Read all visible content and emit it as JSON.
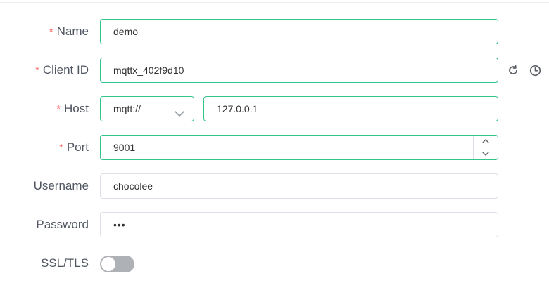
{
  "form": {
    "name": {
      "label": "Name",
      "required_mark": "*",
      "value": "demo"
    },
    "client_id": {
      "label": "Client ID",
      "required_mark": "*",
      "value": "mqttx_402f9d10"
    },
    "host": {
      "label": "Host",
      "required_mark": "*",
      "protocol": "mqtt://",
      "value": "127.0.0.1"
    },
    "port": {
      "label": "Port",
      "required_mark": "*",
      "value": "9001"
    },
    "username": {
      "label": "Username",
      "value": "chocolee"
    },
    "password": {
      "label": "Password",
      "value": "•••"
    },
    "ssl": {
      "label": "SSL/TLS",
      "enabled": false
    }
  },
  "icons": {
    "refresh": "refresh-icon",
    "history": "clock-icon",
    "chevron": "chevron-down-icon"
  },
  "colors": {
    "accent": "#34c388",
    "required": "#f56c6c",
    "label": "#4f5560",
    "border": "#dcdfe6",
    "switch_off": "#aeb1b6"
  }
}
